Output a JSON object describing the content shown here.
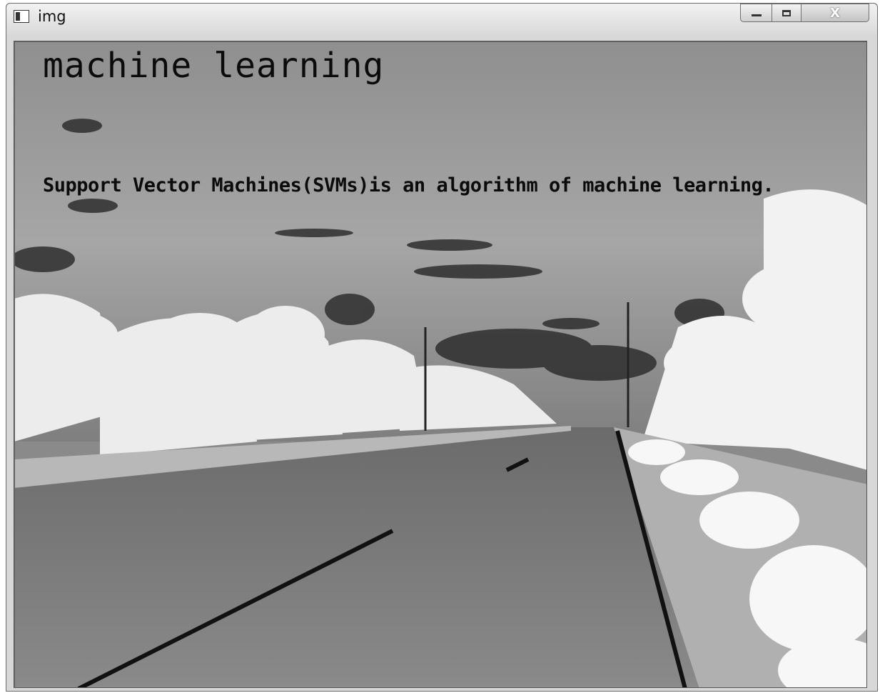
{
  "window": {
    "title": "img",
    "controls": {
      "minimize": "minimize-icon",
      "maximize": "maximize-icon",
      "close_label": "X"
    }
  },
  "image": {
    "heading": "machine learning",
    "caption": "Support Vector Machines(SVMs)is an algorithm of machine learning.",
    "colors": {
      "text": "#0b0b0b",
      "sky": "#9a9a9a",
      "road": "#6e6e6e",
      "foliage": "#f0f0f0"
    }
  }
}
